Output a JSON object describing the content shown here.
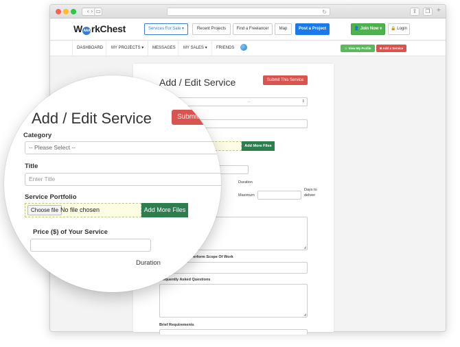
{
  "site": {
    "logo_prefix": "W",
    "logo_badge": "AAA",
    "logo_suffix": "rkChest"
  },
  "topnav": {
    "services_label": "Services For Sale",
    "recent_projects_label": "Recent Projects",
    "find_freelancer_label": "Find a Freelancer",
    "map_label": "Map",
    "post_project_label": "Post a Project",
    "join_now_label": "Join Now",
    "login_label": "Login"
  },
  "subnav": {
    "items": [
      "DASHBOARD",
      "MY PROJECTS",
      "MESSAGES",
      "MY SALES",
      "FRIENDS"
    ],
    "view_profile_label": "View My Profile",
    "add_service_label": "Add a Service"
  },
  "form": {
    "title": "Add / Edit Service",
    "submit_label": "Submit This Service",
    "category_select_value": "-- Please Select --",
    "category_select_value_partial": "--",
    "add_more_files_label": "Add More Files",
    "duration_label": "Duration",
    "maximum_label": "Maximum",
    "days_to_deliver": "Days to deliver",
    "partial_scope_label": "sed to Perform Scope Of Work",
    "faq_label": "Frequently Asked Questions",
    "brief_requirements_label": "Brief Requirements"
  },
  "magnifier": {
    "title": "Add / Edit Service",
    "submit_partial": "Submit",
    "category_label": "Category",
    "category_value": "-- Please Select --",
    "title_label": "Title",
    "title_placeholder": "Enter Title",
    "portfolio_label": "Service Portfolio",
    "choose_file_label": "Choose file",
    "no_file_label": "No file chosen",
    "add_more_files_label": "Add More Files",
    "price_label": "Price ($) of Your Service",
    "duration_label": "Duration"
  },
  "colors": {
    "primary": "#1a7ae8",
    "success": "#4db34d",
    "danger": "#d9534f",
    "add_files": "#2e7d4f"
  }
}
